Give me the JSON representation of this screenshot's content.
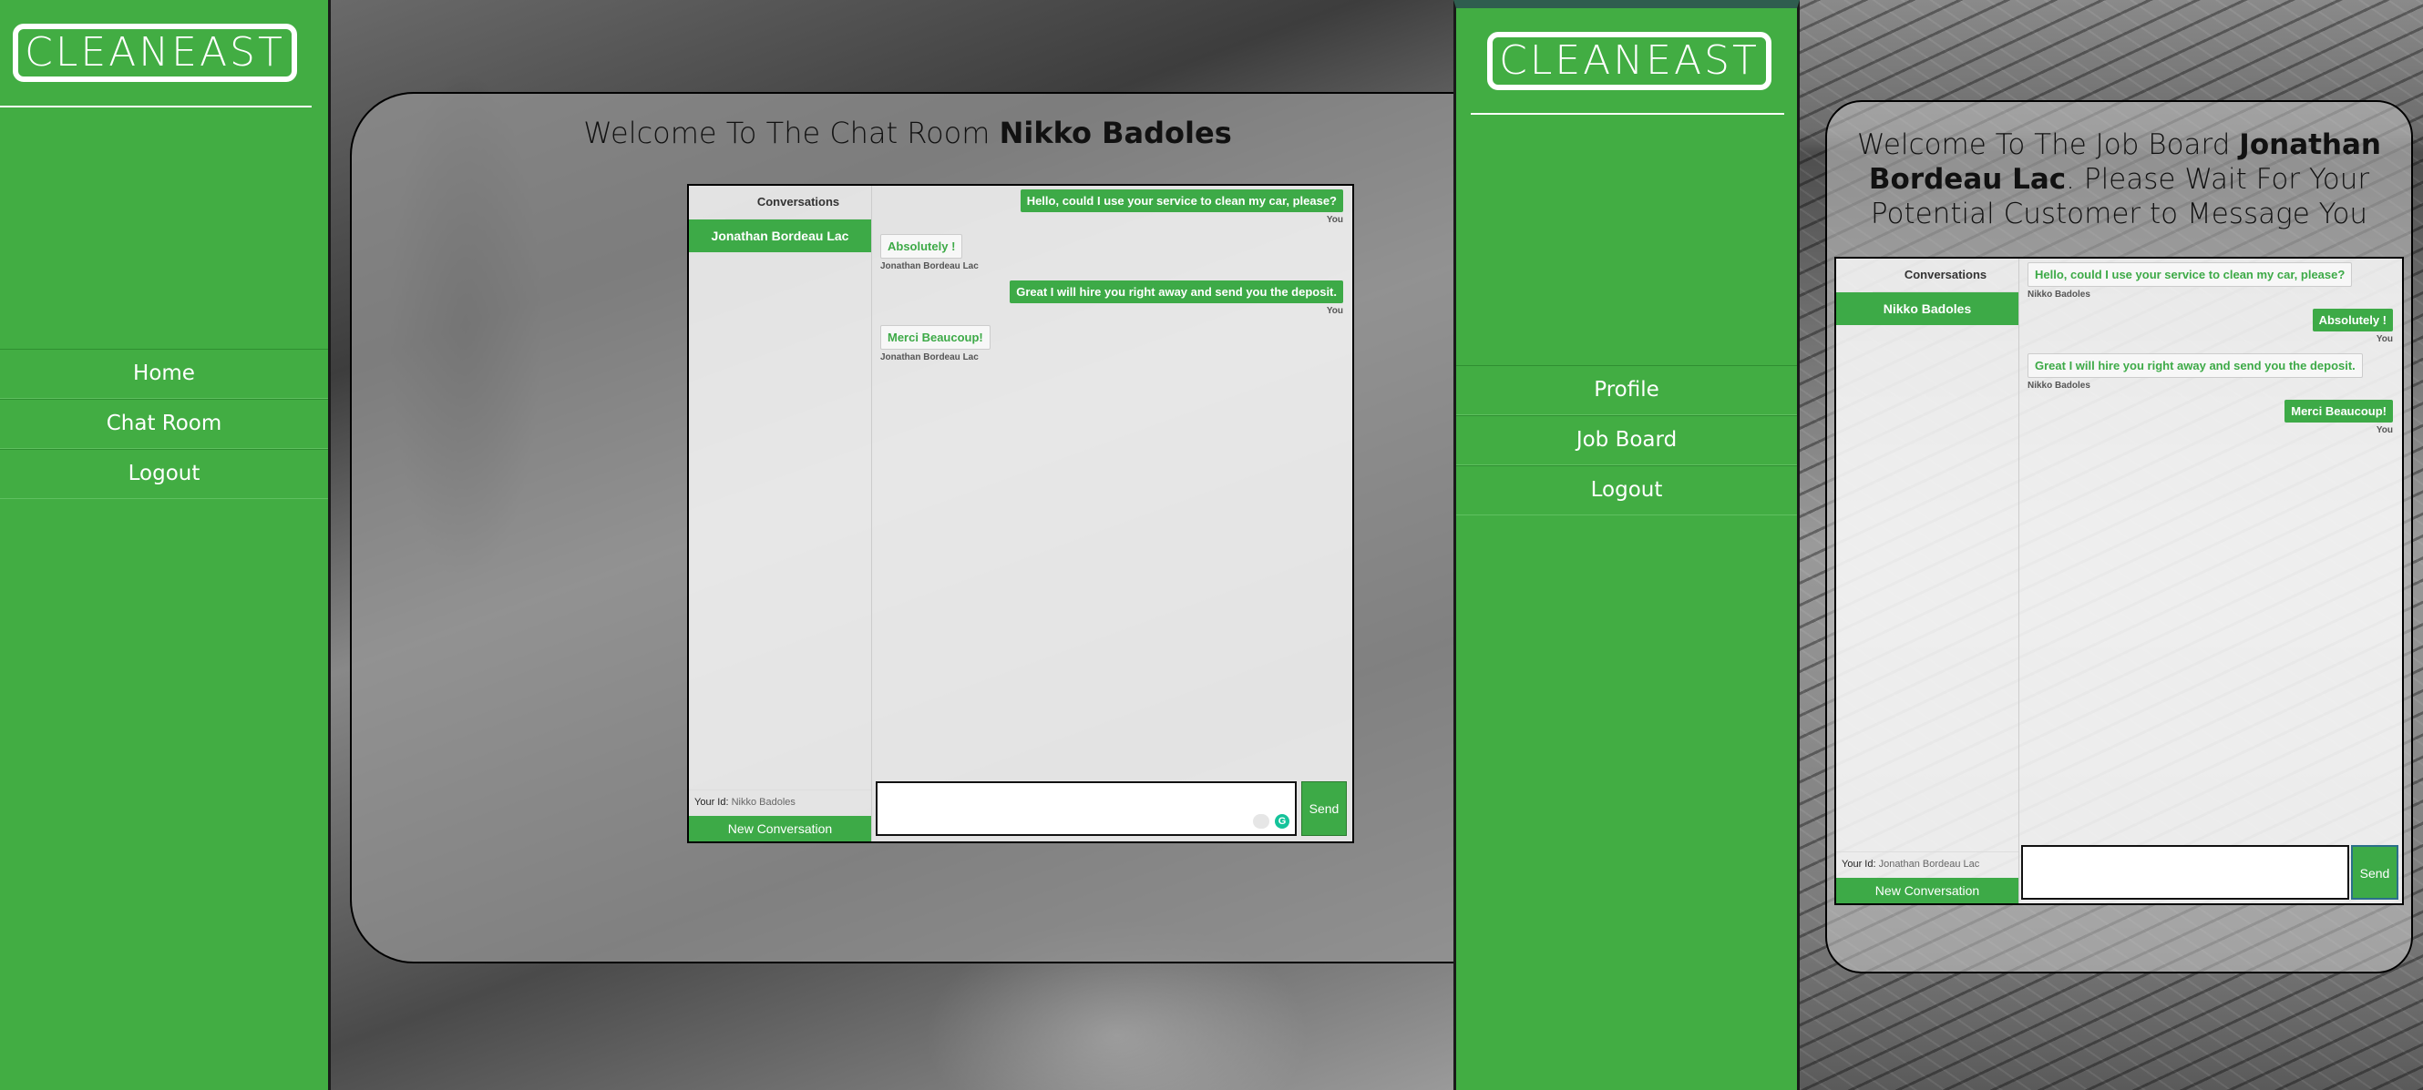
{
  "left_window": {
    "logo": "CLEANEAST",
    "nav": [
      "Home",
      "Chat Room",
      "Logout"
    ],
    "welcome_prefix": "Welcome To The Chat Room ",
    "welcome_name": "Nikko Badoles",
    "conversations_header": "Conversations",
    "conversation_items": [
      "Jonathan Bordeau Lac"
    ],
    "messages": [
      {
        "dir": "out",
        "text": "Hello, could I use your service to clean my car, please?",
        "sender": "You"
      },
      {
        "dir": "in",
        "text": "Absolutely !",
        "sender": "Jonathan Bordeau Lac"
      },
      {
        "dir": "out",
        "text": "Great I will hire you right away and send you the deposit.",
        "sender": "You"
      },
      {
        "dir": "in",
        "text": "Merci Beaucoup!",
        "sender": "Jonathan Bordeau Lac"
      }
    ],
    "your_id_label": "Your Id:",
    "your_id_value": "Nikko Badoles",
    "new_conversation": "New Conversation",
    "send": "Send"
  },
  "right_window": {
    "logo": "CLEANEAST",
    "nav": [
      "Profile",
      "Job Board",
      "Logout"
    ],
    "welcome_prefix": "Welcome To The Job Board ",
    "welcome_name": "Jonathan Bordeau Lac",
    "welcome_suffix": ". Please Wait For Your Potential Customer to Message You",
    "conversations_header": "Conversations",
    "conversation_items": [
      "Nikko Badoles"
    ],
    "messages": [
      {
        "dir": "in",
        "text": "Hello, could I use your service to clean my car, please?",
        "sender": "Nikko Badoles"
      },
      {
        "dir": "out",
        "text": "Absolutely !",
        "sender": "You"
      },
      {
        "dir": "in",
        "text": "Great I will hire you right away and send you the deposit.",
        "sender": "Nikko Badoles"
      },
      {
        "dir": "out",
        "text": "Merci Beaucoup!",
        "sender": "You"
      }
    ],
    "your_id_label": "Your Id:",
    "your_id_value": "Jonathan Bordeau Lac",
    "new_conversation": "New Conversation",
    "send": "Send"
  },
  "colors": {
    "brand_green": "#42ad43",
    "bubble_green": "#3daa47"
  },
  "icons": {
    "grammarly": "grammarly-icon"
  }
}
